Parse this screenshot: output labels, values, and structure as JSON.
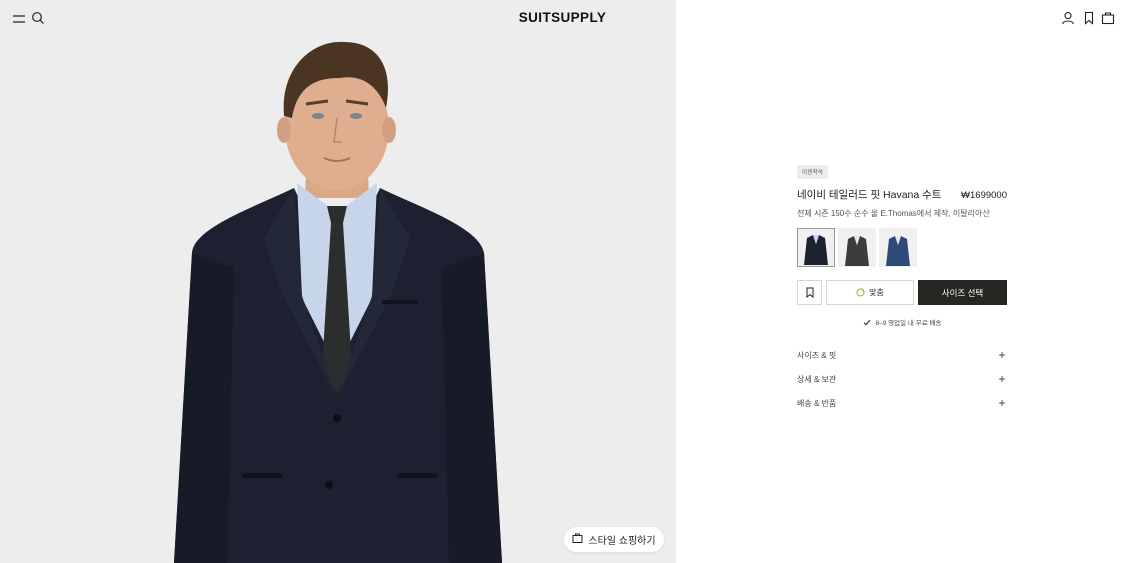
{
  "header": {
    "logo": "SUITSUPPLY",
    "menu_icon": "hamburger-menu-icon",
    "search_icon": "search-icon",
    "account_icon": "user-icon",
    "wishlist_icon": "bookmark-icon",
    "cart_icon": "bag-icon"
  },
  "gallery": {
    "style_button_label": "스타일 쇼핑하기",
    "style_button_icon": "shopping-bag-icon"
  },
  "product": {
    "badge": "이젠착석",
    "title": "네이비 테일러드 핏 Havana 수트",
    "price": "₩1699000",
    "subtitle": "전체 시즌 150수 순수 울 E.Thomas에서 제작, 이탈리아산",
    "swatches": [
      {
        "name": "navy",
        "color": "#1b2130"
      },
      {
        "name": "dark-grey",
        "color": "#3c3c3e"
      },
      {
        "name": "blue",
        "color": "#304a78"
      }
    ],
    "fit_label": "맞춤",
    "size_label": "사이즈 선택",
    "shipping_note": "8–9 영업일 내 무료 배송",
    "accordion": [
      "사이즈 & 핏",
      "상세 & 보관",
      "배송 & 반품"
    ]
  },
  "colors": {
    "left_bg": "#ededed",
    "primary_button": "#262522",
    "suit": "#1c2030",
    "shirt": "#c7d5ea",
    "tie": "#2b2e2d"
  }
}
